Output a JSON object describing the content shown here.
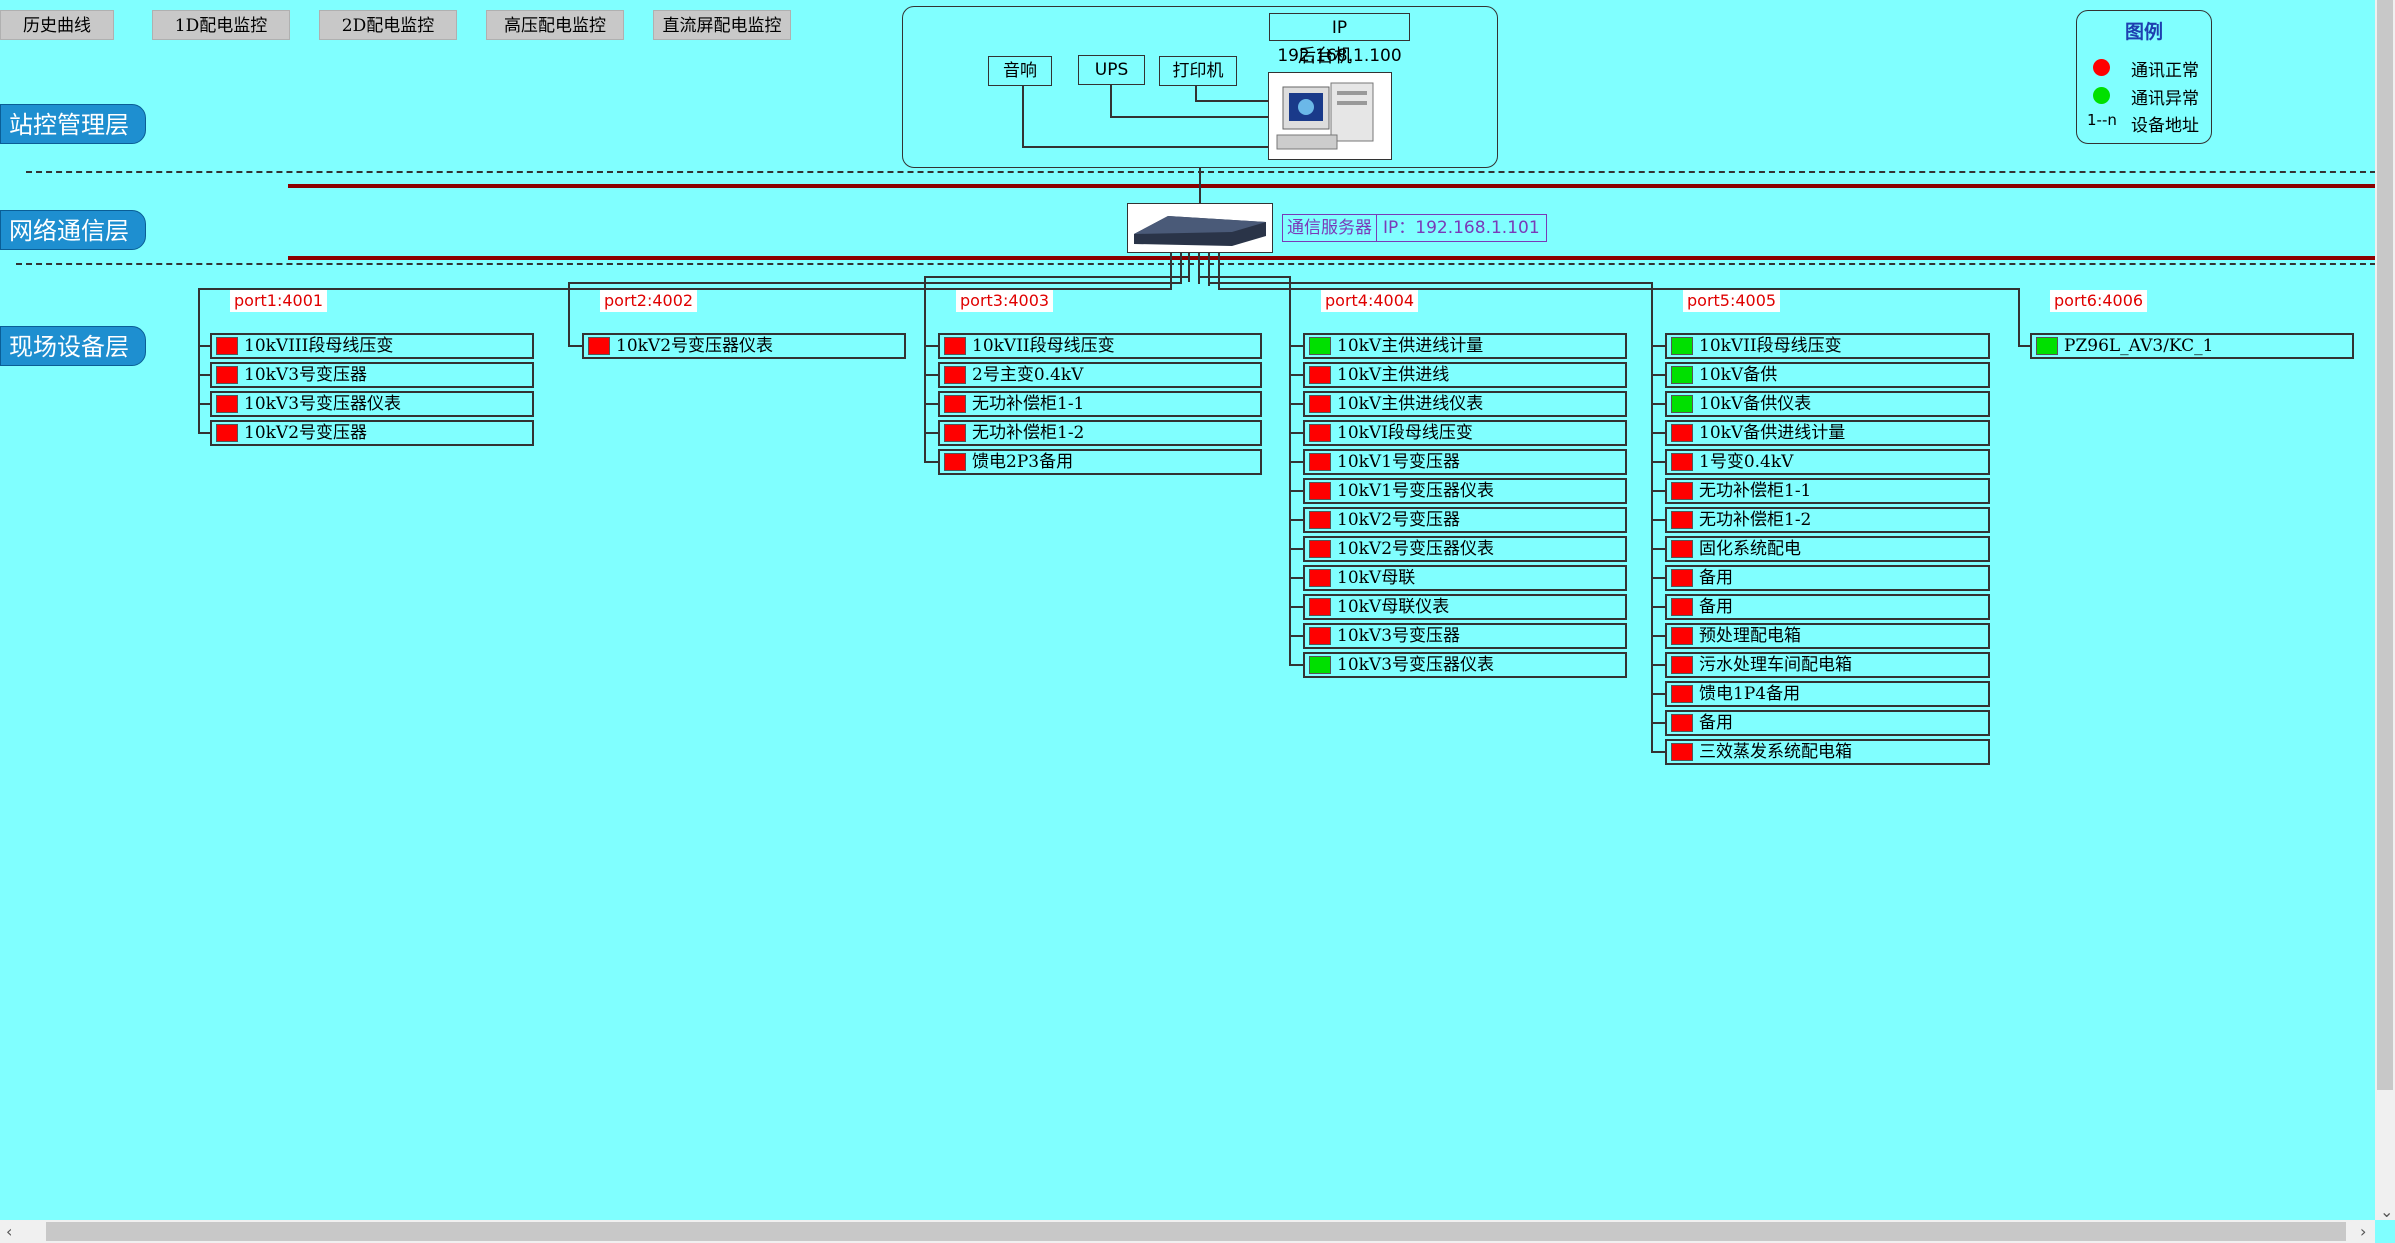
{
  "nav": [
    "历史曲线",
    "1D配电监控",
    "2D配电监控",
    "高压配电监控",
    "直流屏配电监控"
  ],
  "layers": {
    "station": "站控管理层",
    "network": "网络通信层",
    "field": "现场设备层"
  },
  "top": {
    "ip": "IP 192.168.1.100",
    "backend": "后台机",
    "speaker": "音响",
    "ups": "UPS",
    "printer": "打印机"
  },
  "server": {
    "label": "通信服务器",
    "ip": "IP：192.168.1.101"
  },
  "legend": {
    "title": "图例",
    "normal": "通讯正常",
    "abnormal": "通讯异常",
    "address_key": "1--n",
    "address": "设备地址",
    "normal_color": "#FF0000",
    "abnormal_color": "#00E000"
  },
  "ports": [
    {
      "name": "port1:4001",
      "devices": [
        {
          "label": "10kVIII段母线压变",
          "status": "red"
        },
        {
          "label": "10kV3号变压器",
          "status": "red"
        },
        {
          "label": "10kV3号变压器仪表",
          "status": "red"
        },
        {
          "label": "10kV2号变压器",
          "status": "red"
        }
      ]
    },
    {
      "name": "port2:4002",
      "devices": [
        {
          "label": "10kV2号变压器仪表",
          "status": "red"
        }
      ]
    },
    {
      "name": "port3:4003",
      "devices": [
        {
          "label": "10kVII段母线压变",
          "status": "red"
        },
        {
          "label": "2号主变0.4kV",
          "status": "red"
        },
        {
          "label": "无功补偿柜1-1",
          "status": "red"
        },
        {
          "label": "无功补偿柜1-2",
          "status": "red"
        },
        {
          "label": "馈电2P3备用",
          "status": "red"
        }
      ]
    },
    {
      "name": "port4:4004",
      "devices": [
        {
          "label": "10kV主供进线计量",
          "status": "green"
        },
        {
          "label": "10kV主供进线",
          "status": "red"
        },
        {
          "label": "10kV主供进线仪表",
          "status": "red"
        },
        {
          "label": "10kVI段母线压变",
          "status": "red"
        },
        {
          "label": "10kV1号变压器",
          "status": "red"
        },
        {
          "label": "10kV1号变压器仪表",
          "status": "red"
        },
        {
          "label": "10kV2号变压器",
          "status": "red"
        },
        {
          "label": "10kV2号变压器仪表",
          "status": "red"
        },
        {
          "label": "10kV母联",
          "status": "red"
        },
        {
          "label": "10kV母联仪表",
          "status": "red"
        },
        {
          "label": "10kV3号变压器",
          "status": "red"
        },
        {
          "label": "10kV3号变压器仪表",
          "status": "green"
        }
      ]
    },
    {
      "name": "port5:4005",
      "devices": [
        {
          "label": "10kVII段母线压变",
          "status": "green"
        },
        {
          "label": "10kV备供",
          "status": "green"
        },
        {
          "label": "10kV备供仪表",
          "status": "green"
        },
        {
          "label": "10kV备供进线计量",
          "status": "red"
        },
        {
          "label": "1号变0.4kV",
          "status": "red"
        },
        {
          "label": "无功补偿柜1-1",
          "status": "red"
        },
        {
          "label": "无功补偿柜1-2",
          "status": "red"
        },
        {
          "label": "固化系统配电",
          "status": "red"
        },
        {
          "label": "备用",
          "status": "red"
        },
        {
          "label": "备用",
          "status": "red"
        },
        {
          "label": "预处理配电箱",
          "status": "red"
        },
        {
          "label": "污水处理车间配电箱",
          "status": "red"
        },
        {
          "label": "馈电1P4备用",
          "status": "red"
        },
        {
          "label": "备用",
          "status": "red"
        },
        {
          "label": "三效蒸发系统配电箱",
          "status": "red"
        }
      ]
    },
    {
      "name": "port6:4006",
      "devices": [
        {
          "label": "PZ96L_AV3/KC_1",
          "status": "green"
        }
      ]
    }
  ]
}
